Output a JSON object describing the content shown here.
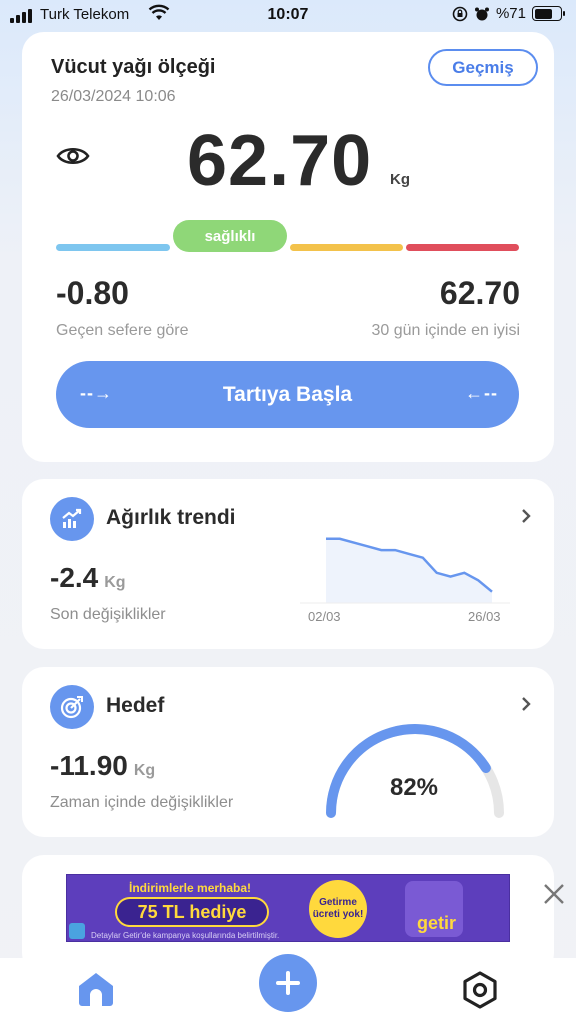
{
  "status_bar": {
    "carrier": "Turk Telekom",
    "time": "10:07",
    "battery": "%71"
  },
  "scale_card": {
    "title": "Vücut yağı ölçeği",
    "datetime": "26/03/2024 10:06",
    "history_button": "Geçmiş",
    "weight_value": "62.70",
    "weight_unit": "Kg",
    "status_label": "sağlıklı",
    "status_colors": [
      "#7ec6ef",
      "#8fd778",
      "#f3c24b",
      "#e04e5c"
    ],
    "change_value": "-0.80",
    "change_caption": "Geçen sefere göre",
    "best_value": "62.70",
    "best_caption": "30 gün içinde en iyisi",
    "start_button": "Tartıya Başla",
    "icon_visibility": "eye-icon"
  },
  "trend_card": {
    "title": "Ağırlık trendi",
    "icon": "trend-chart-icon",
    "value": "-2.4",
    "unit": "Kg",
    "caption": "Son değişiklikler",
    "chart_data": {
      "type": "line",
      "x_start_label": "02/03",
      "x_end_label": "26/03",
      "values": [
        62.9,
        62.9,
        62.8,
        62.7,
        62.6,
        62.6,
        62.5,
        62.4,
        62.0,
        61.9,
        62.0,
        61.8,
        61.5
      ]
    }
  },
  "goal_card": {
    "title": "Hedef",
    "icon": "target-icon",
    "value": "-11.90",
    "unit": "Kg",
    "caption": "Zaman içinde değişiklikler",
    "progress_percent": 82,
    "progress_label": "82%"
  },
  "ad": {
    "line1": "İndirimlerle merhaba!",
    "headline": "75 TL hediye",
    "badge": "Getirme ücreti yok!",
    "brand": "getir",
    "disclaimer": "Detaylar Getir'de kampanya koşullarında belirtilmiştir."
  },
  "bottom_nav": {
    "items": [
      "home-icon",
      "add-icon",
      "settings-icon"
    ]
  },
  "colors": {
    "accent": "#6796ee"
  }
}
